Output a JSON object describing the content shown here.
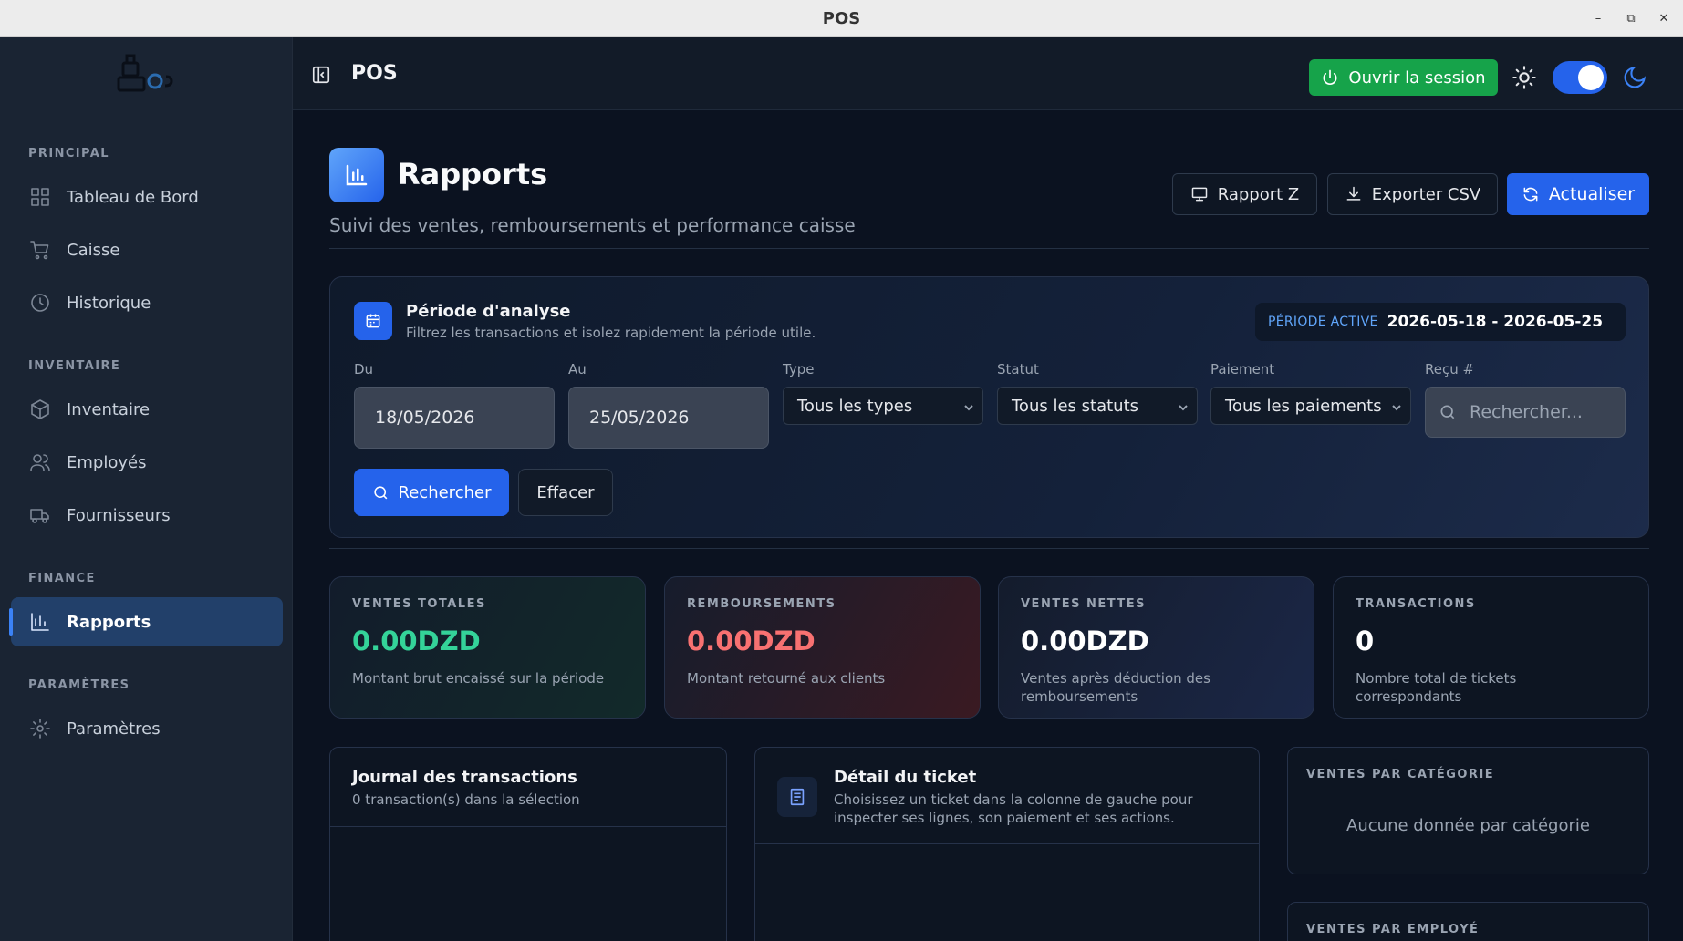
{
  "window": {
    "title": "POS"
  },
  "sidebar": {
    "sections": {
      "principal": "PRINCIPAL",
      "inventaire": "INVENTAIRE",
      "finance": "FINANCE",
      "parametres": "PARAMÈTRES"
    },
    "items": [
      {
        "label": "Tableau de Bord",
        "icon": "grid-icon"
      },
      {
        "label": "Caisse",
        "icon": "cart-icon"
      },
      {
        "label": "Historique",
        "icon": "history-icon"
      },
      {
        "label": "Inventaire",
        "icon": "box-icon"
      },
      {
        "label": "Employés",
        "icon": "users-icon"
      },
      {
        "label": "Fournisseurs",
        "icon": "truck-icon"
      },
      {
        "label": "Rapports",
        "icon": "bar-chart-icon",
        "active": true
      },
      {
        "label": "Paramètres",
        "icon": "gear-icon"
      }
    ]
  },
  "header": {
    "app_name": "POS",
    "session_button": "Ouvrir la session",
    "theme_toggle_on": true
  },
  "page": {
    "title": "Rapports",
    "subtitle": "Suivi des ventes, remboursements et performance caisse",
    "buttons": {
      "rapport_z": "Rapport Z",
      "export_csv": "Exporter CSV",
      "refresh": "Actualiser"
    }
  },
  "filters": {
    "title": "Période d'analyse",
    "subtitle": "Filtrez les transactions et isolez rapidement la période utile.",
    "active_period_label": "PÉRIODE ACTIVE",
    "active_period_value": "2026-05-18 - 2026-05-25",
    "from_label": "Du",
    "from_value": "18/05/2026",
    "to_label": "Au",
    "to_value": "25/05/2026",
    "type_label": "Type",
    "type_value": "Tous les types",
    "status_label": "Statut",
    "status_value": "Tous les statuts",
    "payment_label": "Paiement",
    "payment_value": "Tous les paiements",
    "receipt_label": "Reçu #",
    "receipt_placeholder": "Rechercher...",
    "search_button": "Rechercher",
    "clear_button": "Effacer"
  },
  "stats": [
    {
      "label": "VENTES TOTALES",
      "value": "0.00DZD",
      "desc": "Montant brut encaissé sur la période",
      "color": "#34d399"
    },
    {
      "label": "REMBOURSEMENTS",
      "value": "0.00DZD",
      "desc": "Montant retourné aux clients",
      "color": "#f87171"
    },
    {
      "label": "VENTES NETTES",
      "value": "0.00DZD",
      "desc": "Ventes après déduction des remboursements",
      "color": "#ffffff"
    },
    {
      "label": "TRANSACTIONS",
      "value": "0",
      "desc": "Nombre total de tickets correspondants",
      "color": "#ffffff"
    }
  ],
  "journal": {
    "title": "Journal des transactions",
    "subtitle": "0 transaction(s) dans la sélection"
  },
  "ticket": {
    "title": "Détail du ticket",
    "subtitle": "Choisissez un ticket dans la colonne de gauche pour inspecter ses lignes, son paiement et ses actions."
  },
  "by_category": {
    "label": "VENTES PAR CATÉGORIE",
    "empty": "Aucune donnée par catégorie"
  },
  "by_employee": {
    "label": "VENTES PAR EMPLOYÉ"
  }
}
